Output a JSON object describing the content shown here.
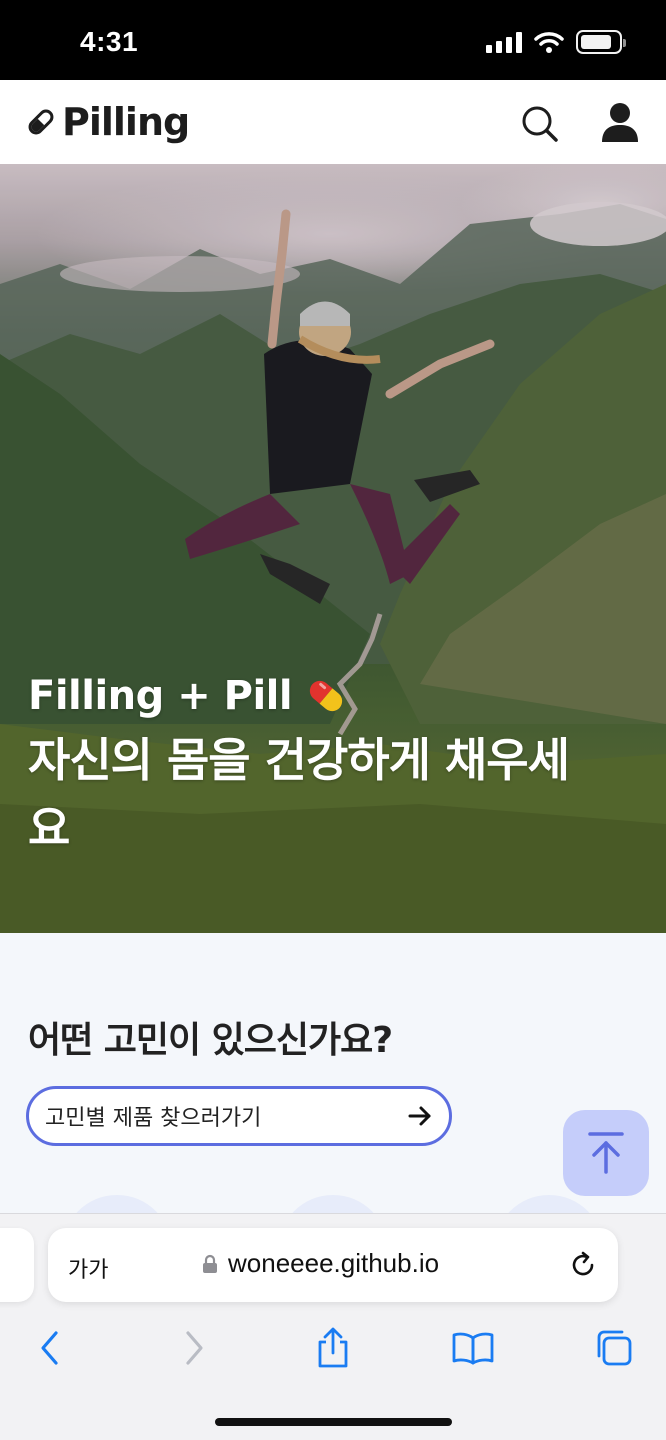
{
  "status_bar": {
    "time": "4:31"
  },
  "header": {
    "logo_text": "Pilling"
  },
  "hero": {
    "subtitle": "Filling + Pill",
    "title": "자신의 몸을 건강하게 채우세요"
  },
  "worries": {
    "title": "어떤 고민이 있으신가요?",
    "button_label": "고민별 제품 찾으러가기"
  },
  "safari": {
    "text_size_label": "가가",
    "url": "woneeee.github.io"
  },
  "colors": {
    "accent": "#5c6de0",
    "scroll_top_bg": "#c5cdfa",
    "ios_blue": "#1a7cf2"
  }
}
